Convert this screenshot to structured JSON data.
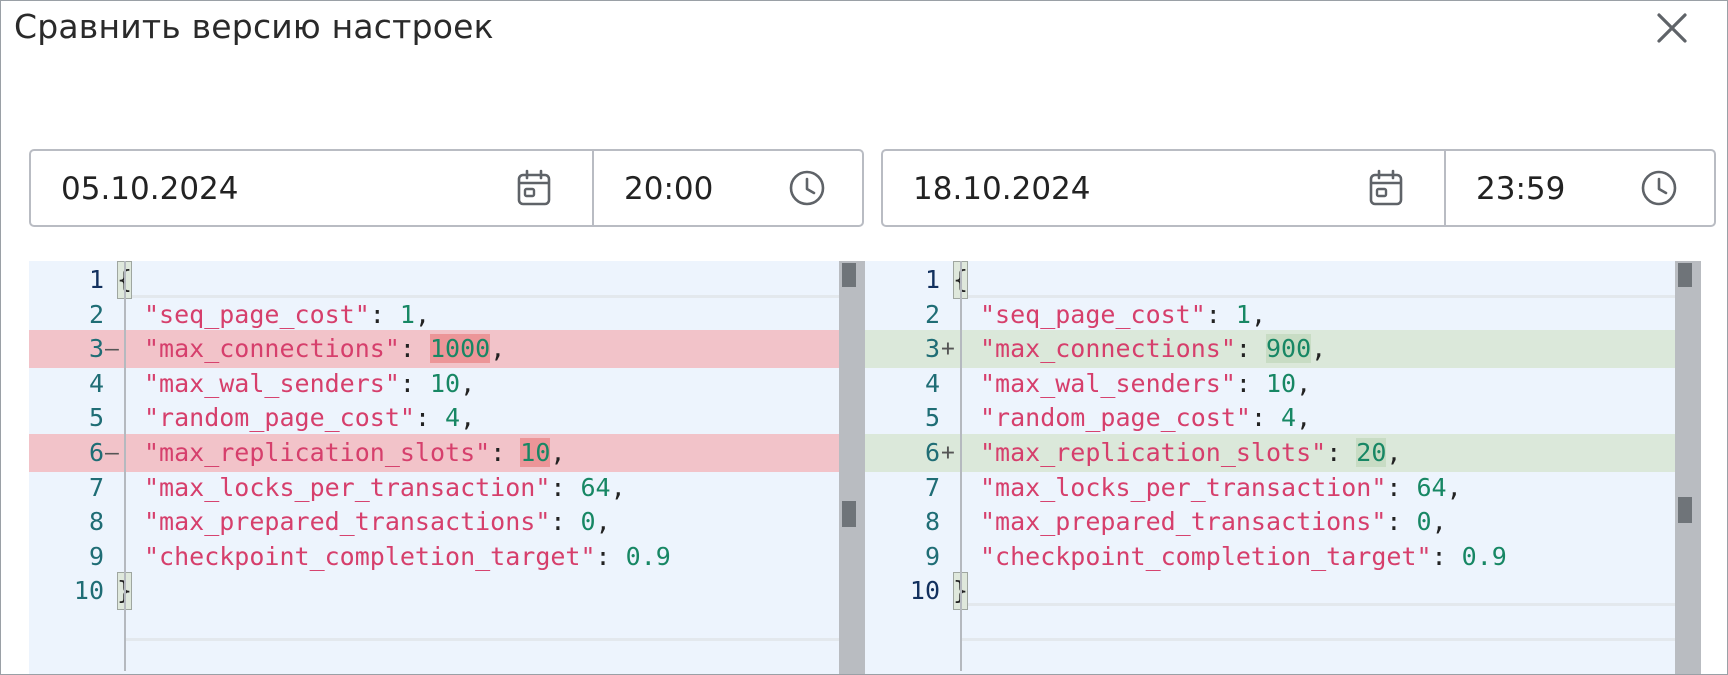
{
  "dialog": {
    "title": "Сравнить версию настроек"
  },
  "left": {
    "date": "05.10.2024",
    "time": "20:00"
  },
  "right": {
    "date": "18.10.2024",
    "time": "23:59"
  },
  "editors": {
    "left": {
      "lines": [
        {
          "n": "1",
          "key": "",
          "value": "",
          "tail": "",
          "brace": "{"
        },
        {
          "n": "2",
          "key": "\"seq_page_cost\"",
          "value": "1",
          "tail": ","
        },
        {
          "n": "3",
          "key": "\"max_connections\"",
          "value": "1000",
          "tail": ",",
          "marker": "—",
          "diff": "removed"
        },
        {
          "n": "4",
          "key": "\"max_wal_senders\"",
          "value": "10",
          "tail": ","
        },
        {
          "n": "5",
          "key": "\"random_page_cost\"",
          "value": "4",
          "tail": ","
        },
        {
          "n": "6",
          "key": "\"max_replication_slots\"",
          "value": "10",
          "tail": ",",
          "marker": "—",
          "diff": "removed"
        },
        {
          "n": "7",
          "key": "\"max_locks_per_transaction\"",
          "value": "64",
          "tail": ","
        },
        {
          "n": "8",
          "key": "\"max_prepared_transactions\"",
          "value": "0",
          "tail": ","
        },
        {
          "n": "9",
          "key": "\"checkpoint_completion_target\"",
          "value": "0.9",
          "tail": ""
        },
        {
          "n": "10",
          "key": "",
          "value": "",
          "tail": "",
          "brace": "}"
        }
      ]
    },
    "right": {
      "lines": [
        {
          "n": "1",
          "key": "",
          "value": "",
          "tail": "",
          "brace": "{"
        },
        {
          "n": "2",
          "key": "\"seq_page_cost\"",
          "value": "1",
          "tail": ","
        },
        {
          "n": "3",
          "key": "\"max_connections\"",
          "value": "900",
          "tail": ",",
          "marker": "+",
          "diff": "added"
        },
        {
          "n": "4",
          "key": "\"max_wal_senders\"",
          "value": "10",
          "tail": ","
        },
        {
          "n": "5",
          "key": "\"random_page_cost\"",
          "value": "4",
          "tail": ","
        },
        {
          "n": "6",
          "key": "\"max_replication_slots\"",
          "value": "20",
          "tail": ",",
          "marker": "+",
          "diff": "added"
        },
        {
          "n": "7",
          "key": "\"max_locks_per_transaction\"",
          "value": "64",
          "tail": ","
        },
        {
          "n": "8",
          "key": "\"max_prepared_transactions\"",
          "value": "0",
          "tail": ","
        },
        {
          "n": "9",
          "key": "\"checkpoint_completion_target\"",
          "value": "0.9",
          "tail": ""
        },
        {
          "n": "10",
          "key": "",
          "value": "",
          "tail": "",
          "brace": "}"
        }
      ]
    }
  },
  "colors": {
    "removed_bg": "#f2c3c9",
    "added_bg": "#dbe8da",
    "key": "#d63f6c",
    "number": "#178764",
    "editor_bg": "#edf4fd"
  },
  "icons": [
    "close-icon",
    "calendar-icon",
    "clock-icon"
  ]
}
